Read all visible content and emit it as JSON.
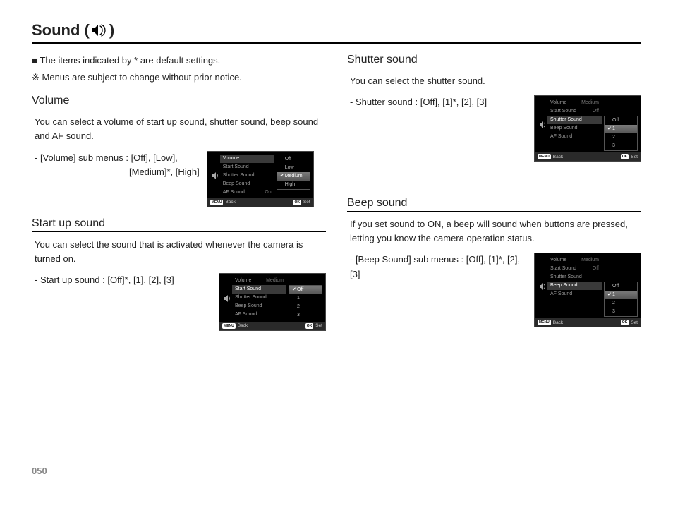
{
  "page": {
    "title_prefix": "Sound (",
    "title_suffix": ")",
    "number": "050"
  },
  "notes": {
    "n1": "The items indicated by * are default settings.",
    "n2": "Menus are subject to change without prior notice."
  },
  "volume": {
    "heading": "Volume",
    "text": "You can select a volume of start up sound, shutter sound, beep sound and AF sound.",
    "sub_l1": "- [Volume] sub menus : [Off], [Low],",
    "sub_l2": "[Medium]*, [High]",
    "ui": {
      "rows": {
        "volume": "Volume",
        "start": "Start Sound",
        "shutter": "Shutter Sound",
        "beep": "Beep Sound",
        "af": "AF Sound",
        "af_val": "On"
      },
      "opts": {
        "off": "Off",
        "low": "Low",
        "medium": "Medium",
        "high": "High"
      },
      "footer": {
        "menu": "MENU",
        "back": "Back",
        "ok": "OK",
        "set": "Set"
      }
    }
  },
  "startup": {
    "heading": "Start up sound",
    "text": "You can select the sound that is activated whenever the camera is turned on.",
    "sub": "- Start up sound : [Off]*, [1], [2], [3]",
    "ui": {
      "rows": {
        "volume": "Volume",
        "volume_val": "Medium",
        "start": "Start Sound",
        "shutter": "Shutter Sound",
        "beep": "Beep Sound",
        "af": "AF Sound"
      },
      "opts": {
        "off": "Off",
        "o1": "1",
        "o2": "2",
        "o3": "3"
      },
      "footer": {
        "menu": "MENU",
        "back": "Back",
        "ok": "OK",
        "set": "Set"
      }
    }
  },
  "shutter": {
    "heading": "Shutter sound",
    "text": "You can select the shutter sound.",
    "sub": "- Shutter sound : [Off], [1]*, [2], [3]",
    "ui": {
      "rows": {
        "volume": "Volume",
        "volume_val": "Medium",
        "start": "Start Sound",
        "start_val": "Off",
        "shutter": "Shutter Sound",
        "beep": "Beep Sound",
        "af": "AF Sound"
      },
      "opts": {
        "off": "Off",
        "o1": "1",
        "o2": "2",
        "o3": "3"
      },
      "footer": {
        "menu": "MENU",
        "back": "Back",
        "ok": "OK",
        "set": "Set"
      }
    }
  },
  "beep": {
    "heading": "Beep sound",
    "text": "If you set sound to ON, a beep will sound when buttons are pressed, letting you know the camera operation status.",
    "sub": "- [Beep Sound] sub menus : [Off], [1]*, [2], [3]",
    "ui": {
      "rows": {
        "volume": "Volume",
        "volume_val": "Medium",
        "start": "Start Sound",
        "start_val": "Off",
        "shutter": "Shutter Sound",
        "beep": "Beep Sound",
        "af": "AF Sound"
      },
      "opts": {
        "off": "Off",
        "o1": "1",
        "o2": "2",
        "o3": "3"
      },
      "footer": {
        "menu": "MENU",
        "back": "Back",
        "ok": "OK",
        "set": "Set"
      }
    }
  }
}
